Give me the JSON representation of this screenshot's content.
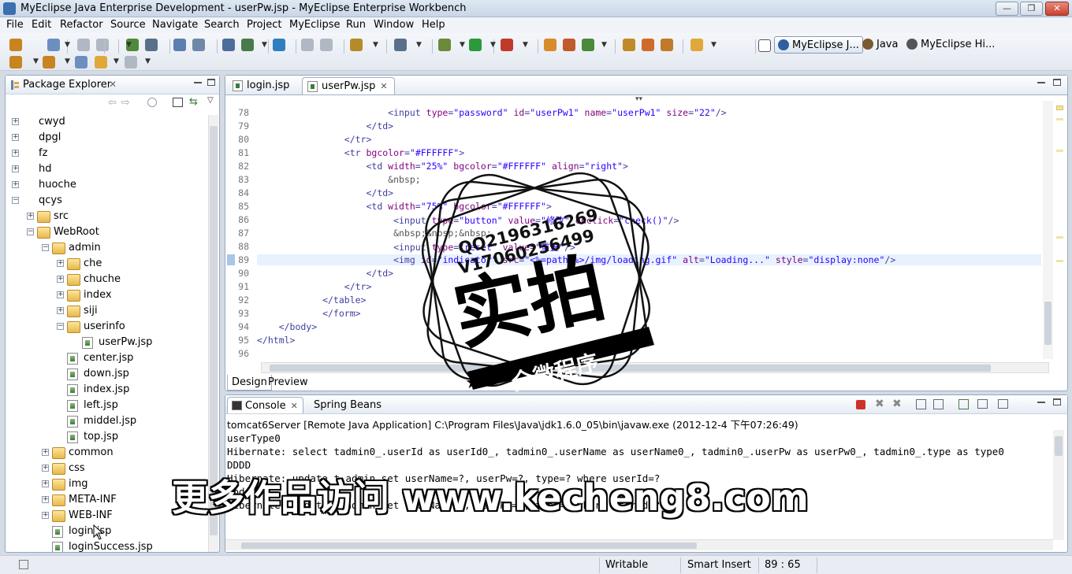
{
  "window": {
    "title": "MyEclipse Java Enterprise Development - userPw.jsp - MyEclipse Enterprise Workbench",
    "min_glyph": "—",
    "max_glyph": "❐",
    "close_glyph": "✕"
  },
  "menu": [
    "File",
    "Edit",
    "Refactor",
    "Source",
    "Navigate",
    "Search",
    "Project",
    "MyEclipse",
    "Run",
    "Window",
    "Help"
  ],
  "perspectives": [
    {
      "label": "MyEclipse J...",
      "active": true
    },
    {
      "label": "Java",
      "active": false
    },
    {
      "label": "MyEclipse Hi...",
      "active": false
    }
  ],
  "package_explorer": {
    "title": "Package Explorer",
    "close_glyph": "✕",
    "tree": [
      {
        "label": "cwyd",
        "kind": "project",
        "depth": 0,
        "expander": "+"
      },
      {
        "label": "dpgl",
        "kind": "project",
        "depth": 0,
        "expander": "+"
      },
      {
        "label": "fz",
        "kind": "project",
        "depth": 0,
        "expander": "+"
      },
      {
        "label": "hd",
        "kind": "project",
        "depth": 0,
        "expander": "+"
      },
      {
        "label": "huoche",
        "kind": "project",
        "depth": 0,
        "expander": "+"
      },
      {
        "label": "qcys",
        "kind": "project",
        "depth": 0,
        "expander": "−"
      },
      {
        "label": "src",
        "kind": "folder",
        "depth": 1,
        "expander": "+"
      },
      {
        "label": "WebRoot",
        "kind": "folder",
        "depth": 1,
        "expander": "−"
      },
      {
        "label": "admin",
        "kind": "folder",
        "depth": 2,
        "expander": "−"
      },
      {
        "label": "che",
        "kind": "folder",
        "depth": 3,
        "expander": "+"
      },
      {
        "label": "chuche",
        "kind": "folder",
        "depth": 3,
        "expander": "+"
      },
      {
        "label": "index",
        "kind": "folder",
        "depth": 3,
        "expander": "+"
      },
      {
        "label": "siji",
        "kind": "folder",
        "depth": 3,
        "expander": "+"
      },
      {
        "label": "userinfo",
        "kind": "folder",
        "depth": 3,
        "expander": "−"
      },
      {
        "label": "userPw.jsp",
        "kind": "jsp",
        "depth": 4,
        "expander": ""
      },
      {
        "label": "center.jsp",
        "kind": "jsp",
        "depth": 3,
        "expander": ""
      },
      {
        "label": "down.jsp",
        "kind": "jsp",
        "depth": 3,
        "expander": ""
      },
      {
        "label": "index.jsp",
        "kind": "jsp",
        "depth": 3,
        "expander": ""
      },
      {
        "label": "left.jsp",
        "kind": "jsp",
        "depth": 3,
        "expander": ""
      },
      {
        "label": "middel.jsp",
        "kind": "jsp",
        "depth": 3,
        "expander": ""
      },
      {
        "label": "top.jsp",
        "kind": "jsp",
        "depth": 3,
        "expander": ""
      },
      {
        "label": "common",
        "kind": "folder",
        "depth": 2,
        "expander": "+"
      },
      {
        "label": "css",
        "kind": "folder",
        "depth": 2,
        "expander": "+"
      },
      {
        "label": "img",
        "kind": "folder",
        "depth": 2,
        "expander": "+"
      },
      {
        "label": "META-INF",
        "kind": "folder",
        "depth": 2,
        "expander": "+"
      },
      {
        "label": "WEB-INF",
        "kind": "folder",
        "depth": 2,
        "expander": "+"
      },
      {
        "label": "login.jsp",
        "kind": "jsp",
        "depth": 2,
        "expander": ""
      },
      {
        "label": "loginSuccess.jsp",
        "kind": "jsp",
        "depth": 2,
        "expander": ""
      }
    ]
  },
  "editor": {
    "tabs": [
      {
        "label": "login.jsp",
        "active": false
      },
      {
        "label": "userPw.jsp",
        "active": true
      }
    ],
    "close_glyph": "✕",
    "lines": [
      {
        "n": "78",
        "text": "                        <input type=\"password\" id=\"userPw1\" name=\"userPw1\" size=\"22\"/>"
      },
      {
        "n": "79",
        "text": "                    </td>"
      },
      {
        "n": "80",
        "text": "                </tr>"
      },
      {
        "n": "81",
        "text": "                <tr bgcolor=\"#FFFFFF\">"
      },
      {
        "n": "82",
        "text": "                    <td width=\"25%\" bgcolor=\"#FFFFFF\" align=\"right\">"
      },
      {
        "n": "83",
        "text": "                        &nbsp;"
      },
      {
        "n": "84",
        "text": "                    </td>"
      },
      {
        "n": "85",
        "text": "                    <td width=\"75%\" bgcolor=\"#FFFFFF\">"
      },
      {
        "n": "86",
        "text": "                         <input type=\"button\" value=\"修改\" onclick=\"check()\"/>"
      },
      {
        "n": "87",
        "text": "                         &nbsp;&nbsp;&nbsp;"
      },
      {
        "n": "88",
        "text": "                         <input type=\"reset\" value=\"重置\"/>"
      },
      {
        "n": "89",
        "text": "                         <img id=\"indicator\" src=\"<%=path %>/img/loading.gif\" alt=\"Loading...\" style=\"display:none\"/>",
        "current": true
      },
      {
        "n": "90",
        "text": "                    </td>"
      },
      {
        "n": "91",
        "text": "                </tr>"
      },
      {
        "n": "92",
        "text": "            </table>"
      },
      {
        "n": "93",
        "text": "            </form>"
      },
      {
        "n": "94",
        "text": "    </body>"
      },
      {
        "n": "95",
        "text": "</html>"
      },
      {
        "n": "96",
        "text": ""
      }
    ],
    "design_tabs": [
      {
        "label": "Design",
        "active": true
      },
      {
        "label": "Preview",
        "active": false
      }
    ]
  },
  "console": {
    "tabs": [
      {
        "label": "Console",
        "active": true
      },
      {
        "label": "Spring Beans",
        "active": false
      }
    ],
    "description": "tomcat6Server [Remote Java Application] C:\\Program Files\\Java\\jdk1.6.0_05\\bin\\javaw.exe (2012-12-4 下午07:26:49)",
    "output": [
      "userType0",
      "Hibernate: select tadmin0_.userId as userId0_, tadmin0_.userName as userName0_, tadmin0_.userPw as userPw0_, tadmin0_.type as type0",
      "DDDD",
      "Hibernate: update t_admin set userName=?, userPw=?, type=? where userId=?",
      "update",
      "Hibernate: update t_admin set userName=?, userPw=?, type=? where userId=?"
    ]
  },
  "status": {
    "writable": "Writable",
    "insert_mode": "Smart Insert",
    "position": "89 : 65"
  },
  "watermark": {
    "qq1": "QQ2196316269",
    "qq2": "V17060256499",
    "big": "实拍",
    "banner": "全微程序",
    "bottom": "更多作品访问 www.kecheng8.com"
  },
  "colors": {
    "tag": "#3f3f9f",
    "attr": "#7f007f",
    "value": "#2a00ff",
    "highlight": "#e8f2fe"
  }
}
